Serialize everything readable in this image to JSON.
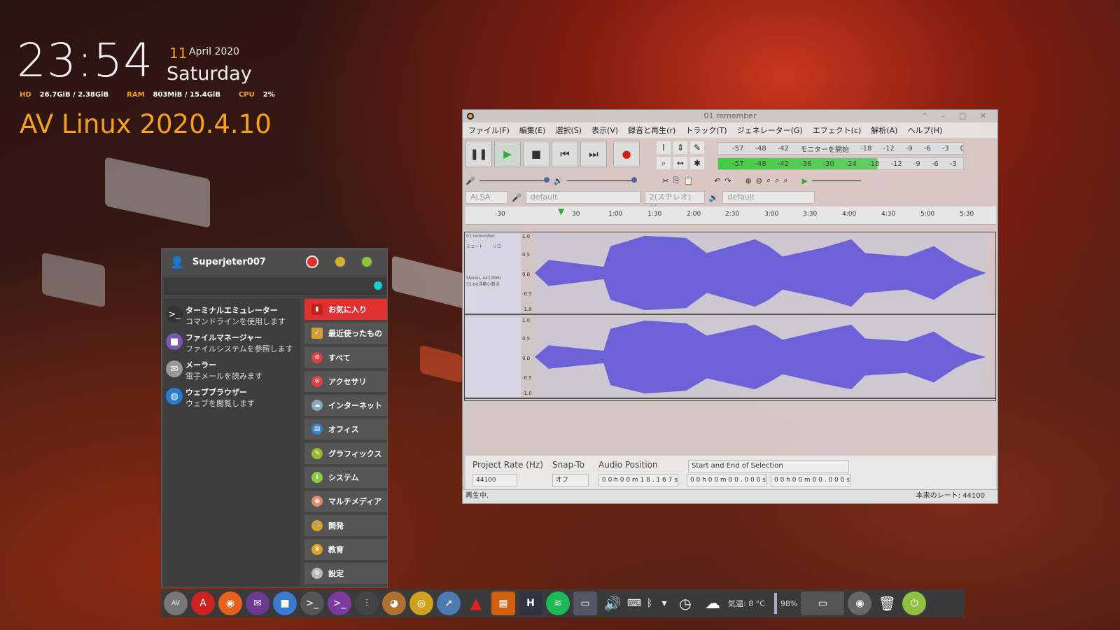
{
  "conky": {
    "time": "23:54",
    "day": "11",
    "month_year": "April 2020",
    "weekday": "Saturday",
    "hd_label": "HD",
    "hd_value": "26.7GiB / 2.38GiB",
    "ram_label": "RAM",
    "ram_value": "803MiB / 15.4GiB",
    "cpu_label": "CPU",
    "cpu_value": "2%",
    "distro": "AV Linux 2020.4.10"
  },
  "audacity": {
    "title": "01 remember",
    "menu": [
      "ファイル(F)",
      "編集(E)",
      "選択(S)",
      "表示(V)",
      "録音と再生(r)",
      "トラック(T)",
      "ジェネレーター(G)",
      "エフェクト(c)",
      "解析(A)",
      "ヘルプ(H)"
    ],
    "meter_rec": [
      "-57",
      "-48",
      "-42",
      "モニターを開始",
      "-18",
      "-12",
      "-9",
      "-6",
      "-3",
      "0"
    ],
    "meter_play": [
      "-57",
      "-48",
      "-42",
      "-36",
      "-30",
      "-24",
      "-18",
      "-12",
      "-9",
      "-6",
      "-3",
      "0"
    ],
    "host": "ALSA",
    "rec_device": "default",
    "channels": "2(ステレオ) 録",
    "play_device": "default",
    "ruler": [
      "-30",
      "0",
      "30",
      "1:00",
      "1:30",
      "2:00",
      "2:30",
      "3:00",
      "3:30",
      "4:00",
      "4:30",
      "5:00",
      "5:30"
    ],
    "track_name": "01 remember",
    "track_mute": "ミュート",
    "track_solo": "ソロ",
    "track_info1": "Stereo, 44100Hz",
    "track_info2": "32-bit浮動小数点",
    "scale": [
      "1.0",
      "0.5",
      "0.0",
      "-0.5",
      "-1.0"
    ],
    "project_rate_label": "Project Rate (Hz)",
    "project_rate": "44100",
    "snap_label": "Snap-To",
    "snap_value": "オフ",
    "audio_pos_label": "Audio Position",
    "audio_pos": "0 0 h 0 0 m 1 8 . 1 6 7 s",
    "selection_mode": "Start and End of Selection",
    "sel_start": "0 0 h 0 0 m 0 0 . 0 0 0 s",
    "sel_end": "0 0 h 0 0 m 0 0 . 0 0 0 s",
    "status": "再生中.",
    "actual_rate": "本来のレート: 44100"
  },
  "menu": {
    "username": "Superjeter007",
    "favorites": [
      {
        "title": "ターミナルエミュレーター",
        "desc": "コマンドラインを使用します"
      },
      {
        "title": "ファイルマネージャー",
        "desc": "ファイルシステムを参照します"
      },
      {
        "title": "メーラー",
        "desc": "電子メールを読みます"
      },
      {
        "title": "ウェブブラウザー",
        "desc": "ウェブを閲覧します"
      }
    ],
    "categories": [
      "お気に入り",
      "最近使ったもの",
      "すべて",
      "アクセサリ",
      "インターネット",
      "オフィス",
      "グラフィックス",
      "システム",
      "マルチメディア",
      "開発",
      "教育",
      "設定"
    ]
  },
  "dock": {
    "weather": "気温: 8 °C",
    "battery": "98%"
  }
}
